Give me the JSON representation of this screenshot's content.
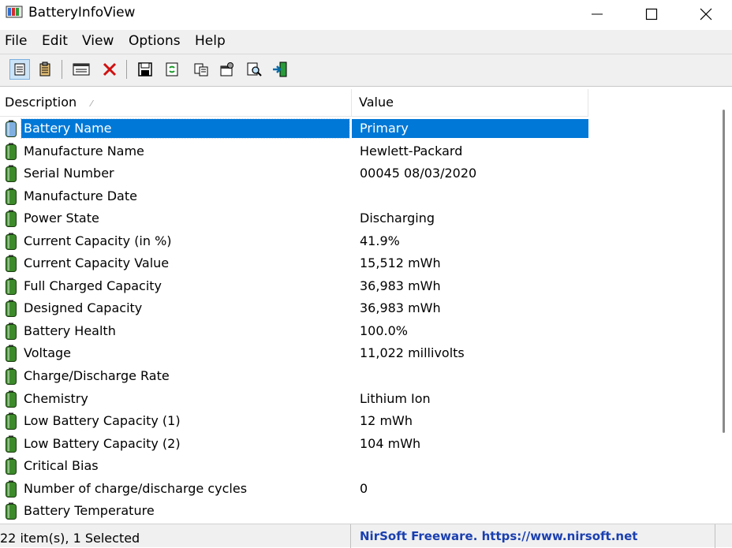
{
  "window": {
    "title": "BatteryInfoView"
  },
  "menu": [
    "File",
    "Edit",
    "View",
    "Options",
    "Help"
  ],
  "toolbar": {
    "buttons": [
      {
        "name": "general-mode-button",
        "icon": "page-icon"
      },
      {
        "name": "battery-log-button",
        "icon": "clipboard-icon"
      },
      {
        "name": "window-button",
        "icon": "window-icon"
      },
      {
        "name": "delete-button",
        "icon": "red-x-icon"
      },
      {
        "name": "save-button",
        "icon": "floppy-icon"
      },
      {
        "name": "refresh-button",
        "icon": "refresh-icon"
      },
      {
        "name": "copy-button",
        "icon": "copy-icon"
      },
      {
        "name": "properties-button",
        "icon": "properties-icon"
      },
      {
        "name": "find-button",
        "icon": "magnifier-icon"
      },
      {
        "name": "exit-button",
        "icon": "exit-icon"
      }
    ]
  },
  "columns": {
    "description": "Description",
    "value": "Value"
  },
  "rows": [
    {
      "description": "Battery Name",
      "value": "Primary",
      "selected": true
    },
    {
      "description": "Manufacture Name",
      "value": "Hewlett-Packard"
    },
    {
      "description": "Serial Number",
      "value": "00045 08/03/2020"
    },
    {
      "description": "Manufacture Date",
      "value": ""
    },
    {
      "description": "Power State",
      "value": "Discharging"
    },
    {
      "description": "Current Capacity (in %)",
      "value": "41.9%"
    },
    {
      "description": "Current Capacity Value",
      "value": "15,512 mWh"
    },
    {
      "description": "Full Charged Capacity",
      "value": "36,983 mWh"
    },
    {
      "description": "Designed Capacity",
      "value": "36,983 mWh"
    },
    {
      "description": "Battery Health",
      "value": "100.0%"
    },
    {
      "description": "Voltage",
      "value": "11,022 millivolts"
    },
    {
      "description": "Charge/Discharge Rate",
      "value": ""
    },
    {
      "description": "Chemistry",
      "value": "Lithium Ion"
    },
    {
      "description": "Low Battery Capacity (1)",
      "value": "12 mWh"
    },
    {
      "description": "Low Battery Capacity (2)",
      "value": "104 mWh"
    },
    {
      "description": "Critical Bias",
      "value": ""
    },
    {
      "description": "Number of charge/discharge cycles",
      "value": "0"
    },
    {
      "description": "Battery Temperature",
      "value": ""
    }
  ],
  "status": {
    "count": "22 item(s), 1 Selected",
    "link": "NirSoft Freeware. https://www.nirsoft.net"
  },
  "colors": {
    "selection": "#0078d7",
    "battery_green": "#3c8a2a",
    "link": "#1a3fb0"
  }
}
